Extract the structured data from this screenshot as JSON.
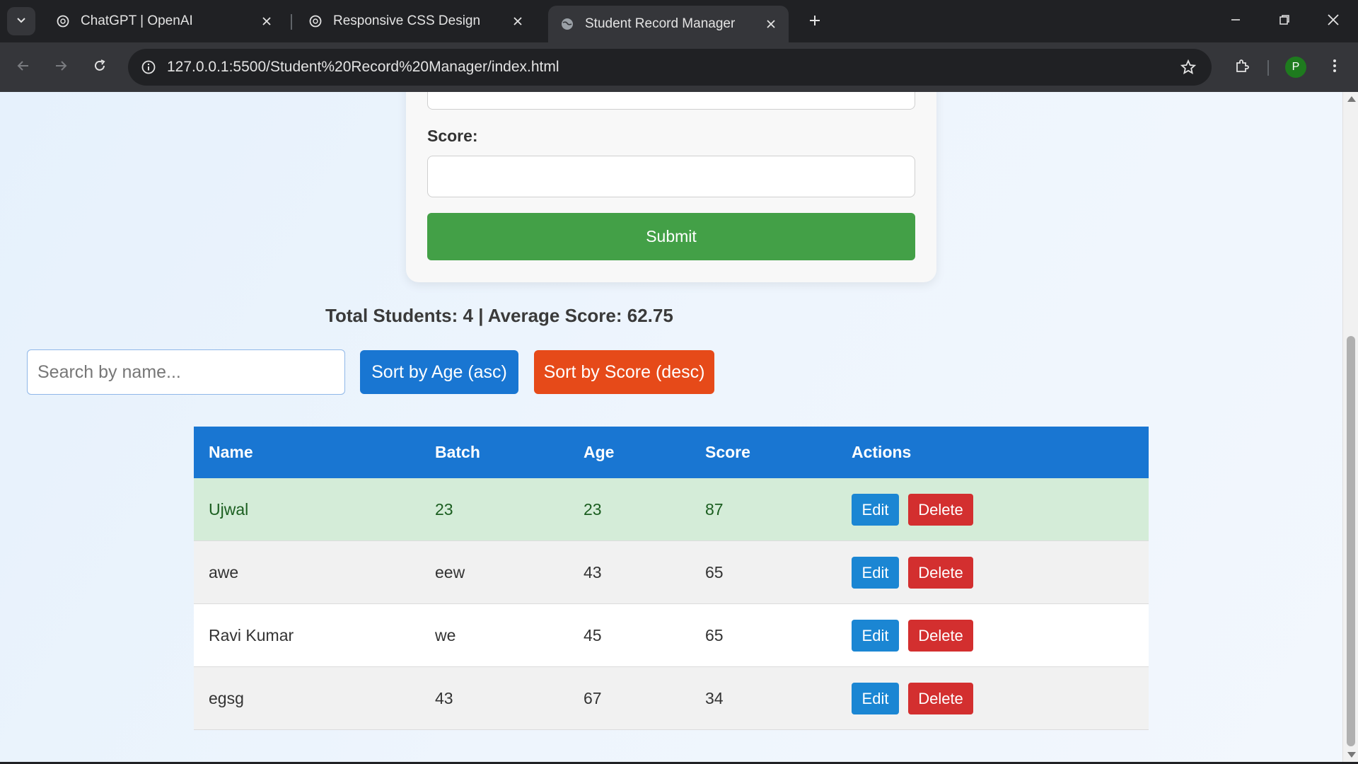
{
  "browser": {
    "tabs": [
      {
        "title": "ChatGPT | OpenAI",
        "icon": "openai-icon",
        "active": false
      },
      {
        "title": "Responsive CSS Design",
        "icon": "openai-icon",
        "active": false
      },
      {
        "title": "Student Record Manager",
        "icon": "globe-icon",
        "active": true
      }
    ],
    "url": "127.0.0.1:5500/Student%20Record%20Manager/index.html",
    "profile_initial": "P"
  },
  "form": {
    "score_label": "Score:",
    "score_value": "",
    "submit_label": "Submit"
  },
  "summary": {
    "text": "Total Students: 4 | Average Score: 62.75"
  },
  "controls": {
    "search_placeholder": "Search by name...",
    "sort_age_label": "Sort by Age (asc)",
    "sort_score_label": "Sort by Score (desc)"
  },
  "table": {
    "headers": {
      "name": "Name",
      "batch": "Batch",
      "age": "Age",
      "score": "Score",
      "actions": "Actions"
    },
    "edit_label": "Edit",
    "delete_label": "Delete",
    "rows": [
      {
        "name": "Ujwal",
        "batch": "23",
        "age": "23",
        "score": "87"
      },
      {
        "name": "awe",
        "batch": "eew",
        "age": "43",
        "score": "65"
      },
      {
        "name": "Ravi Kumar",
        "batch": "we",
        "age": "45",
        "score": "65"
      },
      {
        "name": "egsg",
        "batch": "43",
        "age": "67",
        "score": "34"
      }
    ]
  },
  "colors": {
    "header_blue": "#1976d2",
    "submit_green": "#43a047",
    "sort_score_orange": "#e64a19",
    "delete_red": "#d32f2f",
    "highlight_row": "#d4ecd8"
  }
}
